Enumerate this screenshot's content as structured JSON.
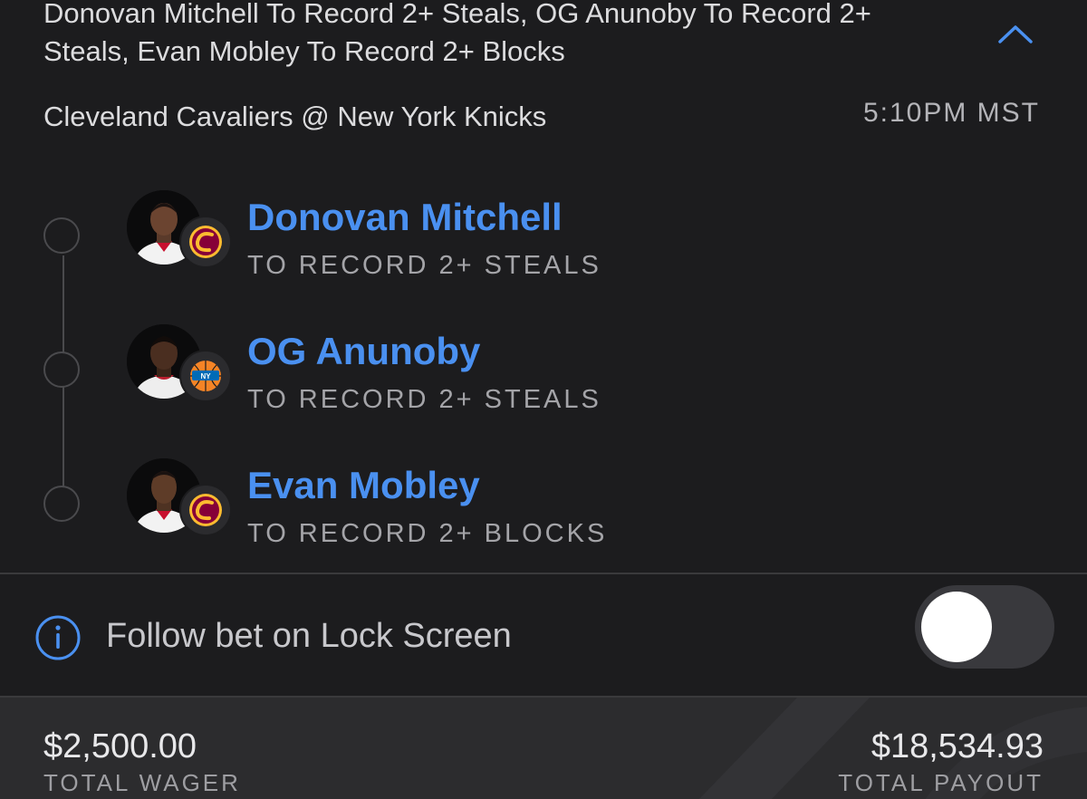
{
  "bet": {
    "title": "Donovan Mitchell To Record 2+ Steals, OG Anunoby To Record 2+ Steals, Evan Mobley To Record 2+ Blocks",
    "matchup": "Cleveland Cavaliers @ New York Knicks",
    "time": "5:10PM MST",
    "collapse_icon": "chevron-up-icon"
  },
  "legs": [
    {
      "player": "Donovan Mitchell",
      "market": "TO RECORD 2+ STEALS",
      "team_logo": "cavaliers-logo-icon"
    },
    {
      "player": "OG Anunoby",
      "market": "TO RECORD 2+ STEALS",
      "team_logo": "knicks-logo-icon"
    },
    {
      "player": "Evan Mobley",
      "market": "TO RECORD 2+ BLOCKS",
      "team_logo": "cavaliers-logo-icon"
    }
  ],
  "follow": {
    "label": "Follow bet on Lock Screen",
    "icon": "info-icon",
    "enabled": false
  },
  "totals": {
    "wager_amount": "$2,500.00",
    "wager_label": "TOTAL WAGER",
    "payout_amount": "$18,534.93",
    "payout_label": "TOTAL PAYOUT"
  },
  "colors": {
    "background": "#1c1c1e",
    "accent": "#4a90f0",
    "footer": "#2c2c2e",
    "cavaliers": "#860038",
    "knicks_orange": "#f58426",
    "knicks_blue": "#006bb6"
  }
}
